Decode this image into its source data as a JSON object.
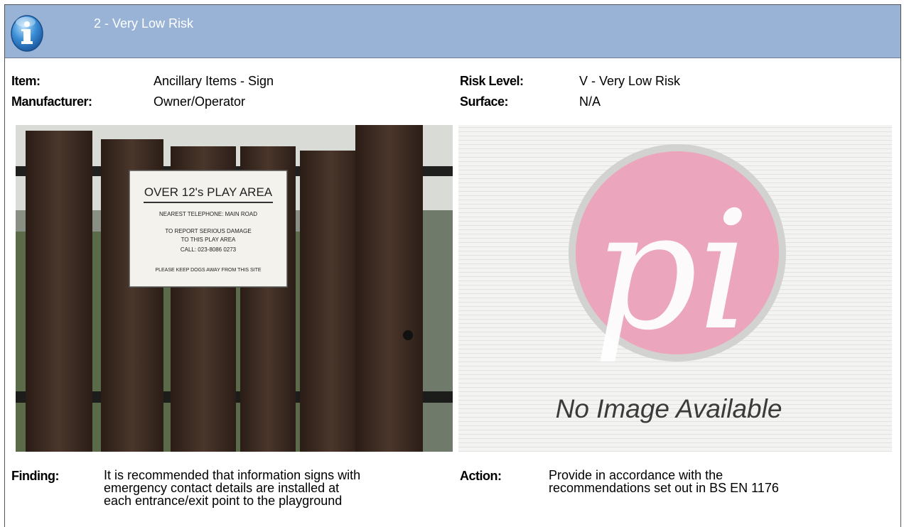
{
  "header": {
    "title": "2 - Very Low Risk",
    "icon": "info-icon",
    "background": "#99b3d6"
  },
  "details": {
    "item_label": "Item:",
    "item_value": "Ancillary Items - Sign",
    "manufacturer_label": "Manufacturer:",
    "manufacturer_value": "Owner/Operator",
    "risk_label": "Risk Level:",
    "risk_value": "V - Very Low Risk",
    "surface_label": "Surface:",
    "surface_value": "N/A"
  },
  "photo": {
    "sign_title": "OVER 12's PLAY AREA",
    "sign_line1": "NEAREST TELEPHONE: MAIN ROAD",
    "sign_line2": "TO REPORT SERIOUS DAMAGE",
    "sign_line3": "TO THIS PLAY AREA",
    "sign_line4": "CALL: 023-8086 0273",
    "sign_line5": "PLEASE KEEP DOGS AWAY FROM THIS SITE"
  },
  "placeholder": {
    "logo_text": "pi",
    "caption": "No Image Available"
  },
  "finding": {
    "label": "Finding:",
    "line1": "It is recommended that information signs with",
    "line2": "emergency contact details are installed at",
    "line3": "each entrance/exit point to the playground"
  },
  "action": {
    "label": "Action:",
    "line1": "Provide in accordance with the",
    "line2": "recommendations set out in BS EN 1176"
  }
}
